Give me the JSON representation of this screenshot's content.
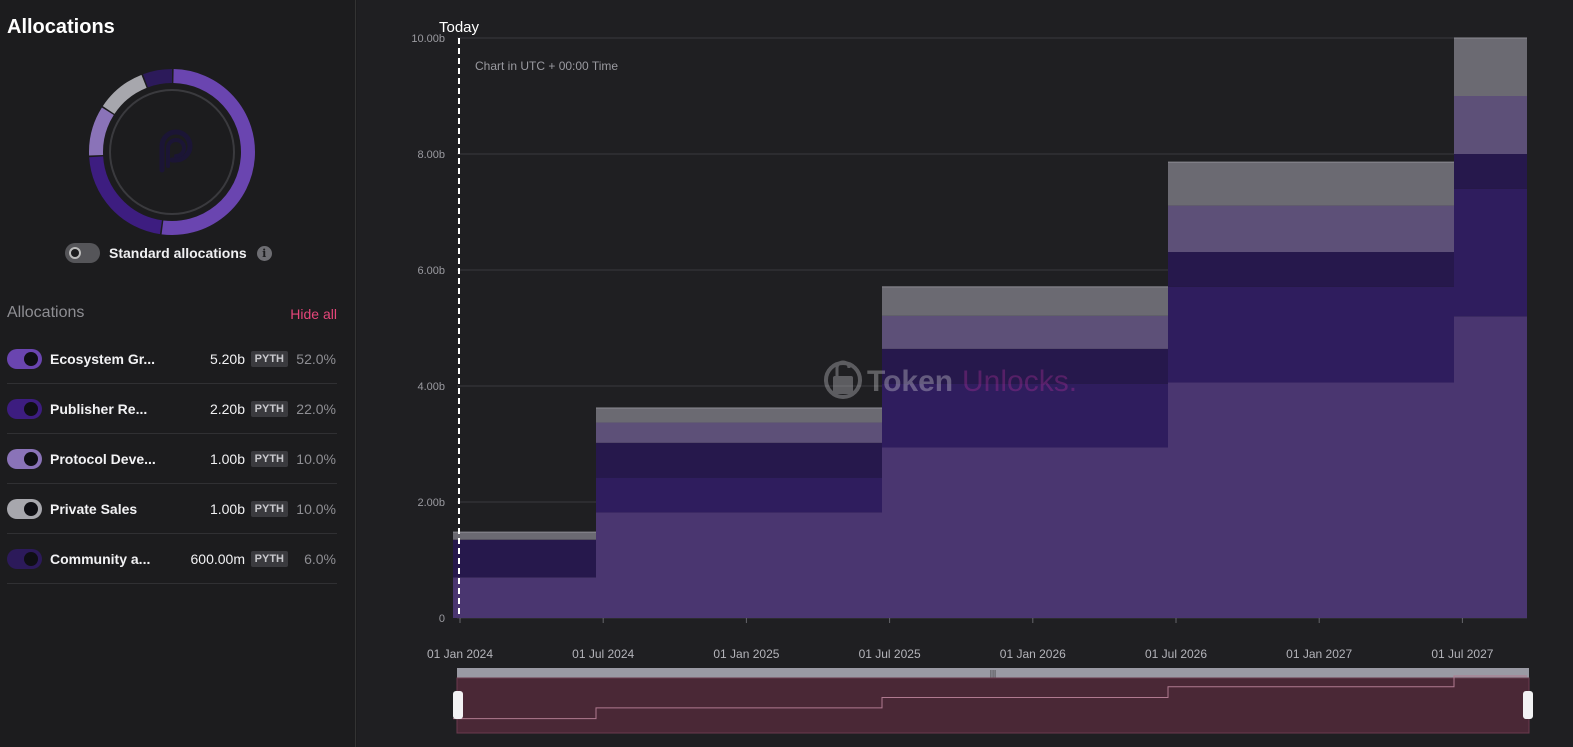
{
  "panel": {
    "title": "Allocations"
  },
  "toggle": {
    "label": "Standard allocations",
    "info_icon": "i"
  },
  "alloc_section": {
    "title": "Allocations",
    "hide_all": "Hide all"
  },
  "allocations": [
    {
      "name": "Ecosystem Gr...",
      "amount": "5.20b",
      "token": "PYTH",
      "pct": "52.0%",
      "color": "#6a45b0"
    },
    {
      "name": "Publisher Re...",
      "amount": "2.20b",
      "token": "PYTH",
      "pct": "22.0%",
      "color": "#3d1d80"
    },
    {
      "name": "Protocol Deve...",
      "amount": "1.00b",
      "token": "PYTH",
      "pct": "10.0%",
      "color": "#8a73b8"
    },
    {
      "name": "Private Sales",
      "amount": "1.00b",
      "token": "PYTH",
      "pct": "10.0%",
      "color": "#a7a7ad"
    },
    {
      "name": "Community a...",
      "amount": "600.00m",
      "token": "PYTH",
      "pct": "6.0%",
      "color": "#2c1a5a"
    }
  ],
  "colors": {
    "accent": "#e5467a",
    "ecosystem": "#4a3670",
    "publisher": "#2f1d5e",
    "protocol_dark": "#26184c",
    "protocol_light": "#5d5078",
    "private": "#6b6a72"
  },
  "chart_data": {
    "type": "area",
    "today_label": "Today",
    "note": "Chart in UTC + 00:00 Time",
    "y_ticks": [
      "0",
      "2.00b",
      "4.00b",
      "6.00b",
      "8.00b",
      "10.00b"
    ],
    "x_ticks": [
      "01 Jan 2024",
      "01 Jul 2024",
      "01 Jan 2025",
      "01 Jul 2025",
      "01 Jan 2026",
      "01 Jul 2026",
      "01 Jan 2027",
      "01 Jul 2027"
    ],
    "ylim": [
      0,
      10
    ],
    "x": [
      "Nov 2023",
      "May 2024",
      "May 2025",
      "May 2026",
      "May 2027"
    ],
    "series": [
      {
        "name": "Ecosystem Gr...",
        "values": [
          0.7,
          1.82,
          2.94,
          4.06,
          5.2
        ],
        "color": "#4a3670"
      },
      {
        "name": "Publisher Re...",
        "values": [
          0.0,
          0.6,
          1.1,
          1.65,
          2.2
        ],
        "color": "#2f1d5e"
      },
      {
        "name": "Community a...",
        "values": [
          0.65,
          0.6,
          0.6,
          0.6,
          0.6
        ],
        "color": "#26184c"
      },
      {
        "name": "Protocol Deve...",
        "values": [
          0.0,
          0.35,
          0.57,
          0.8,
          1.0
        ],
        "color": "#5d5078"
      },
      {
        "name": "Private Sales",
        "values": [
          0.13,
          0.25,
          0.5,
          0.75,
          1.0
        ],
        "color": "#6b6a72"
      }
    ],
    "watermark": {
      "part1": "Token",
      "part2": "Unlocks."
    }
  }
}
